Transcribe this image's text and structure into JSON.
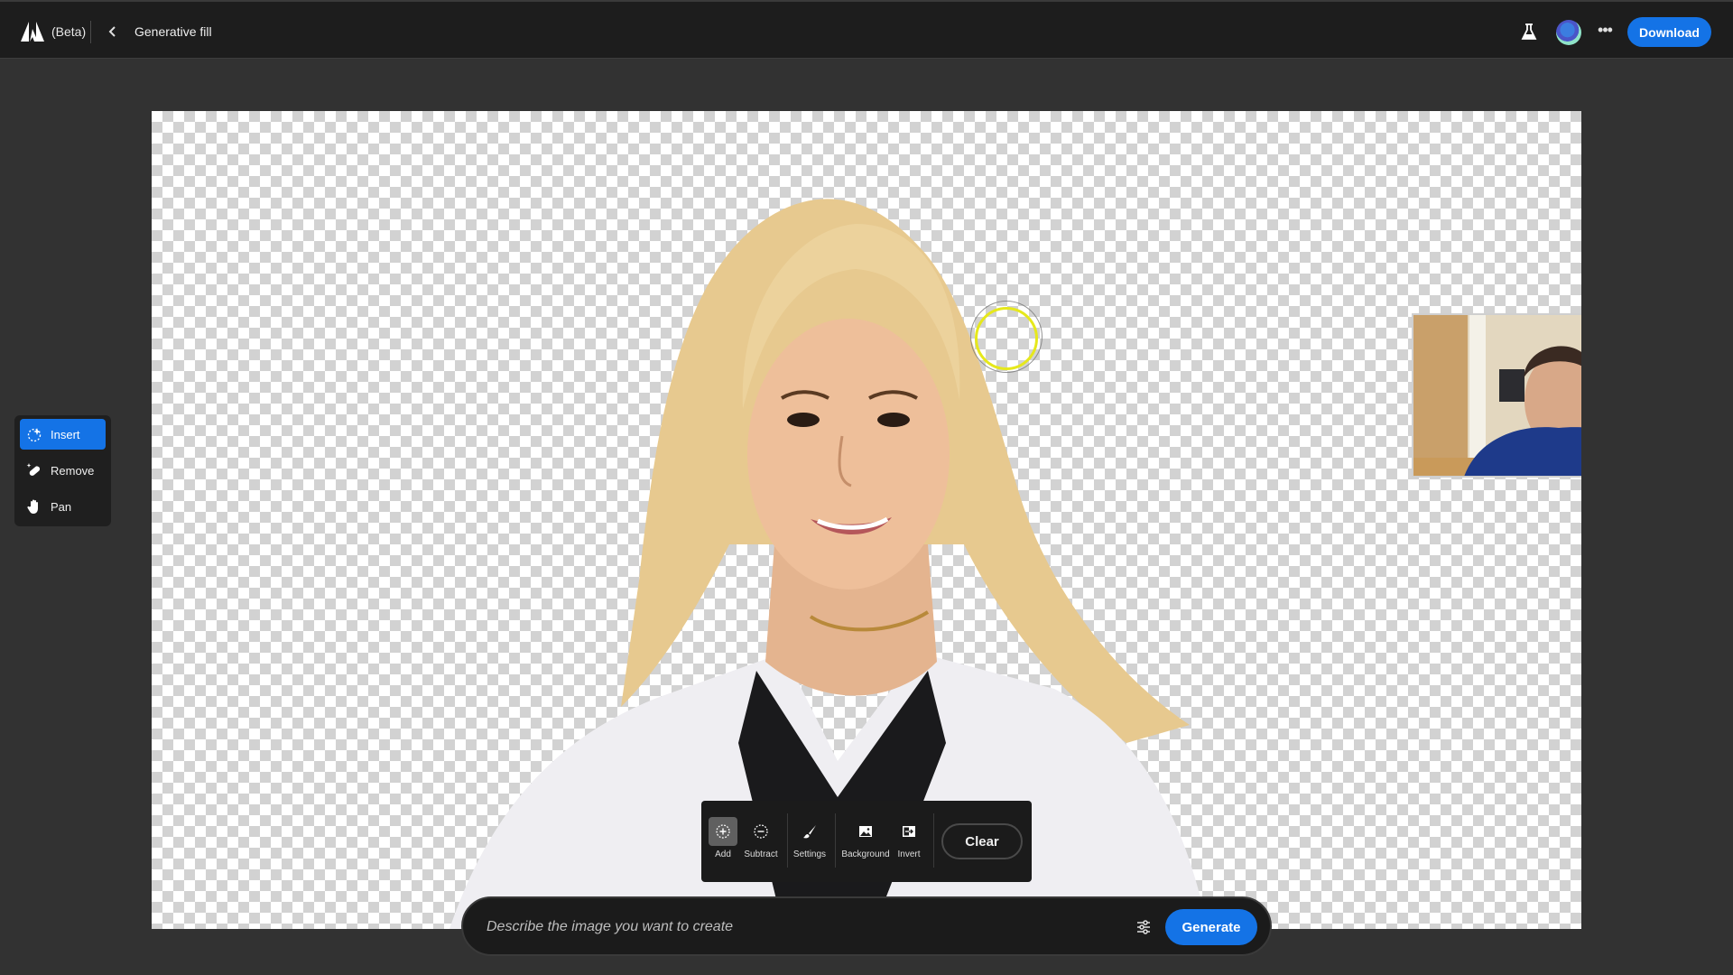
{
  "header": {
    "logo_icon": "adobe-logo-icon",
    "beta_label": "(Beta)",
    "back_icon": "chevron-left-icon",
    "title": "Generative fill",
    "labs_icon": "flask-icon",
    "avatar_icon": "user-avatar",
    "more_icon": "more-horizontal-icon",
    "more_label": "•••",
    "download_label": "Download"
  },
  "tool_panel": {
    "items": [
      {
        "label": "Insert",
        "icon": "insert-sparkle-icon",
        "active": true
      },
      {
        "label": "Remove",
        "icon": "remove-bandage-icon",
        "active": false
      },
      {
        "label": "Pan",
        "icon": "hand-icon",
        "active": false
      }
    ]
  },
  "selection_toolbar": {
    "items": [
      {
        "label": "Add",
        "icon": "add-selection-icon",
        "active": true
      },
      {
        "label": "Subtract",
        "icon": "subtract-selection-icon",
        "active": false
      },
      {
        "label": "Settings",
        "icon": "brush-icon",
        "active": false
      },
      {
        "label": "Background",
        "icon": "image-icon",
        "active": false
      },
      {
        "label": "Invert",
        "icon": "invert-icon",
        "active": false
      }
    ],
    "clear_label": "Clear"
  },
  "prompt": {
    "value": "",
    "placeholder": "Describe the image you want to create",
    "settings_icon": "sliders-icon",
    "generate_label": "Generate"
  },
  "colors": {
    "accent": "#1473e6",
    "header_bg": "#1d1d1d",
    "workspace_bg": "#323232",
    "brush_cursor": "#e6e81c"
  }
}
